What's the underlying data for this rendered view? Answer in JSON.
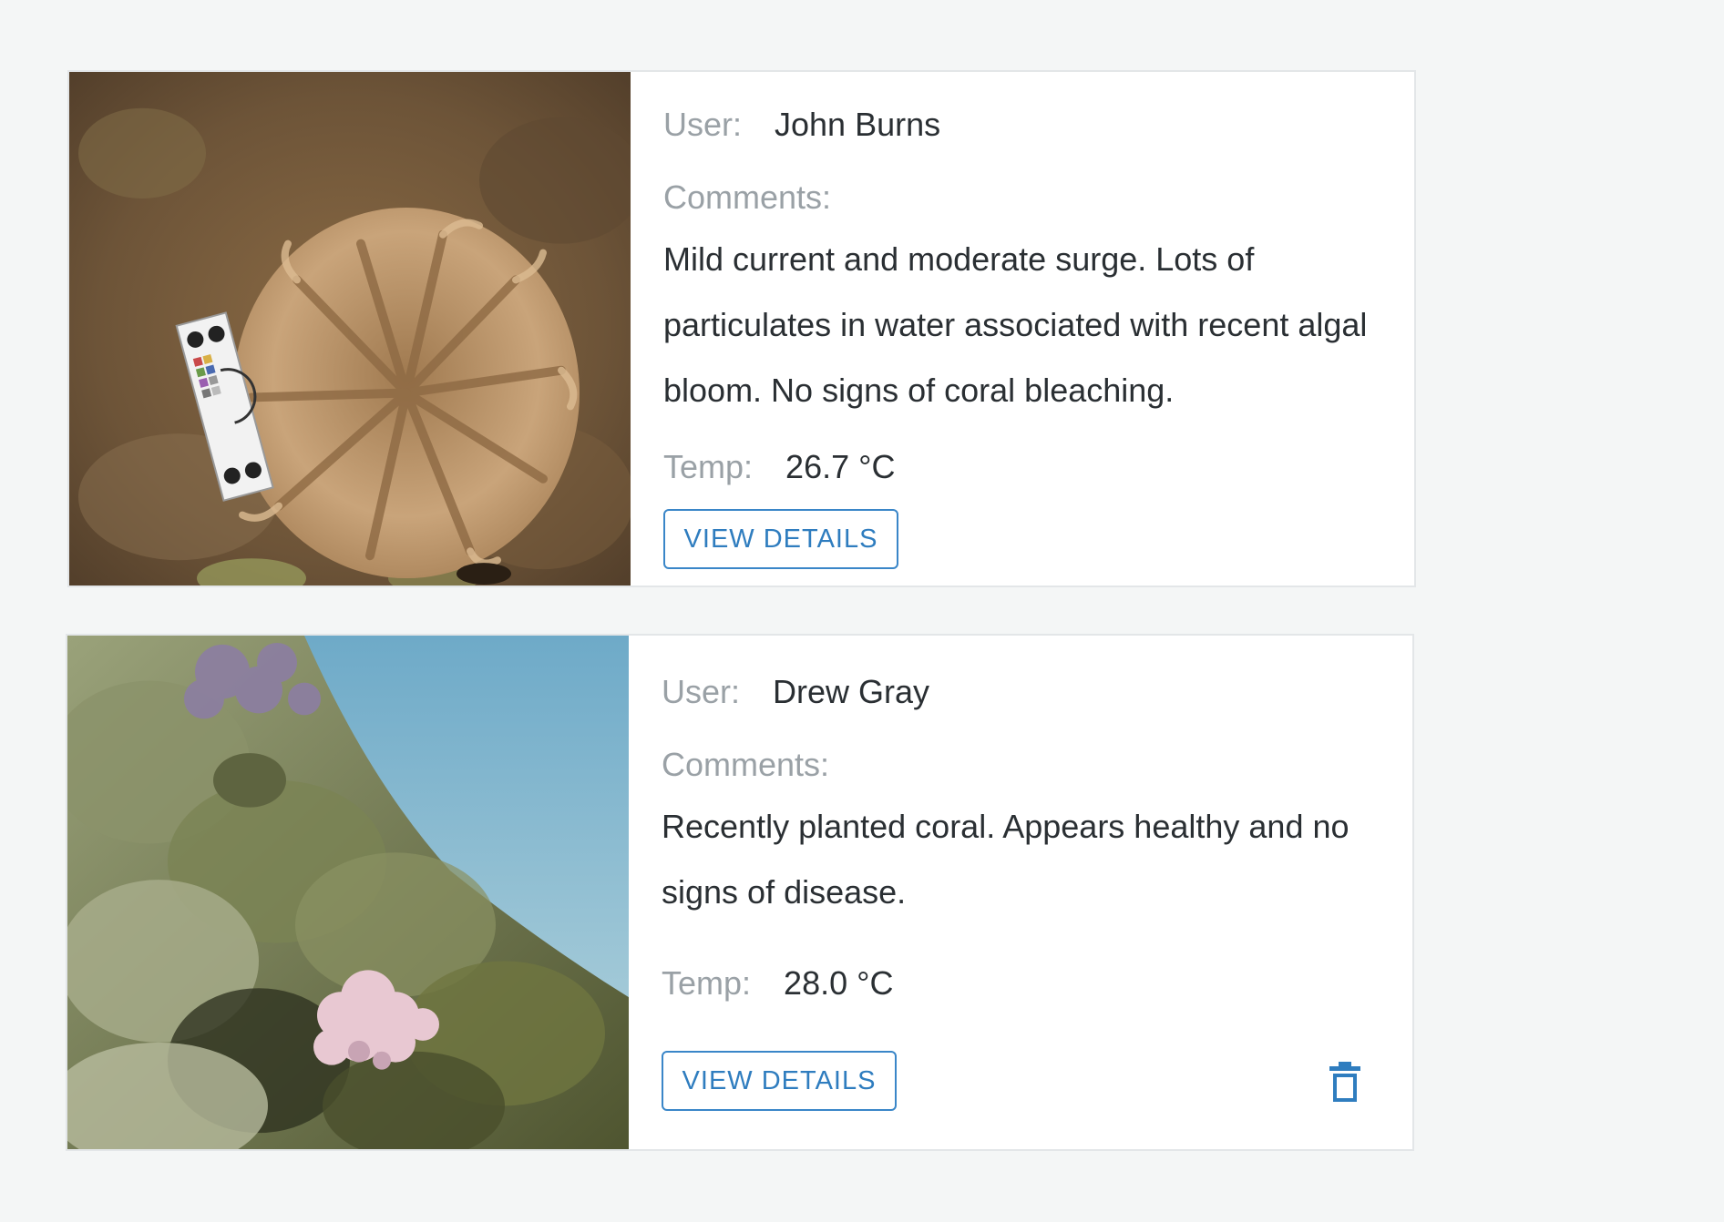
{
  "cards": [
    {
      "photo_alt": "coral-leather-coral-photo",
      "user_label": "User:",
      "user": "John Burns",
      "comments_label": "Comments:",
      "comments": "Mild current and moderate surge. Lots of particulates in water associated with recent algal bloom. No signs of coral bleaching.",
      "temp_label": "Temp:",
      "temp": "26.7 °C",
      "button_label": "VIEW DETAILS"
    },
    {
      "photo_alt": "planted-coral-reef-photo",
      "user_label": "User:",
      "user": "Drew Gray",
      "comments_label": "Comments:",
      "comments": "Recently planted coral. Appears healthy and no signs of disease.",
      "temp_label": "Temp:",
      "temp": "28.0 °C",
      "button_label": "VIEW DETAILS",
      "delete_icon": "trash-icon"
    }
  ],
  "colors": {
    "accent": "#2f7dbf",
    "label": "#9aa1a6",
    "text": "#2a2f33",
    "background": "#f4f6f6"
  }
}
